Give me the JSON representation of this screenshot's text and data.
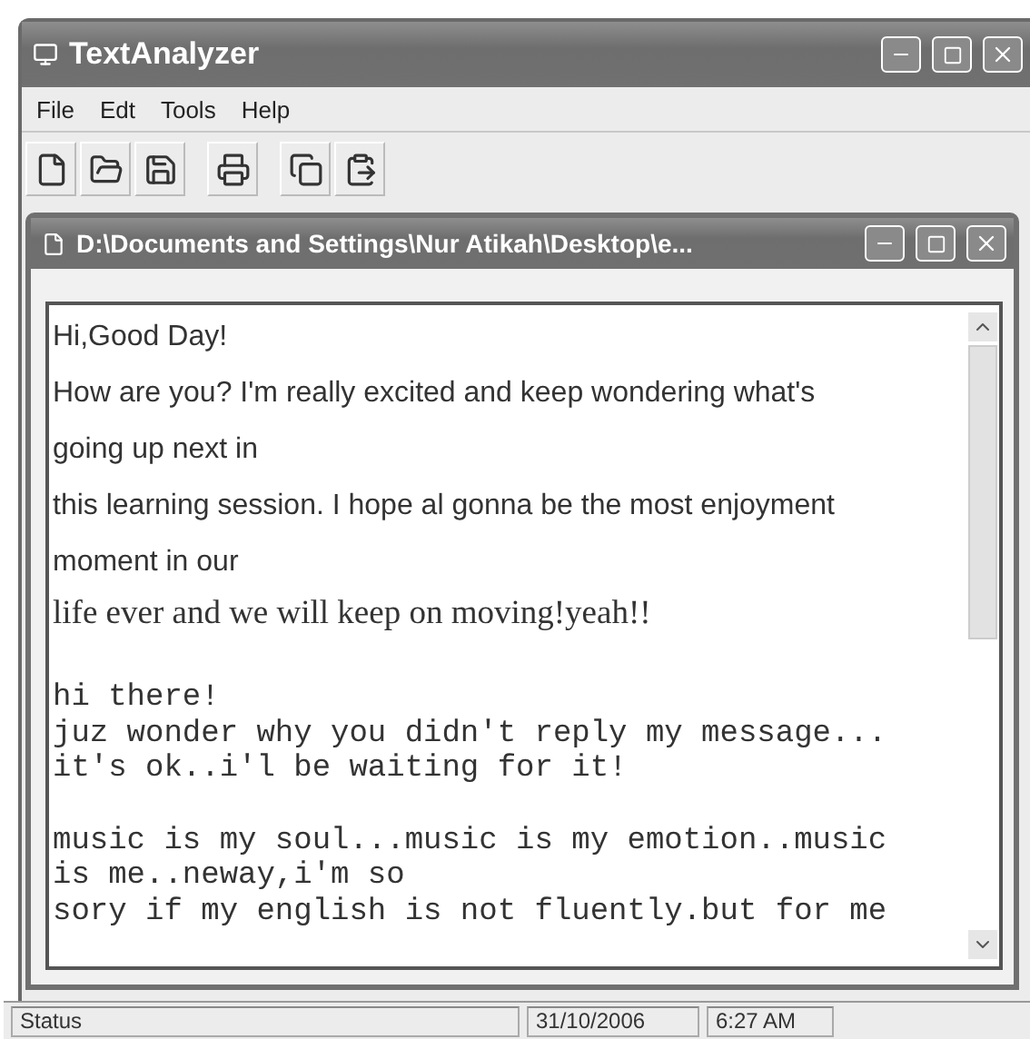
{
  "window": {
    "title": "TextAnalyzer"
  },
  "menu": [
    "File",
    "Edt",
    "Tools",
    "Help"
  ],
  "document": {
    "title": "D:\\Documents and Settings\\Nur Atikah\\Desktop\\e...",
    "paragraphs": [
      {
        "kind": "sans",
        "lines": [
          "Hi,Good Day!",
          "How are you? I'm really excited and keep wondering what's",
          "going up next in",
          "this learning session. I hope al gonna be the most enjoyment",
          "moment in our"
        ]
      },
      {
        "kind": "serif",
        "lines": [
          "life ever and we will keep on moving!yeah!!"
        ]
      },
      {
        "kind": "mono",
        "lines": [
          "hi there!",
          "juz wonder why you didn't reply my message...",
          "it's ok..i'l be waiting for it!"
        ]
      },
      {
        "kind": "mono",
        "lines": [
          "music is my soul...music is my emotion..music",
          "is me..neway,i'm so",
          "sory if my english is not fluently.but for me"
        ]
      }
    ]
  },
  "status_bar": [
    "Status",
    "31/10/2006",
    "6:27 AM"
  ]
}
